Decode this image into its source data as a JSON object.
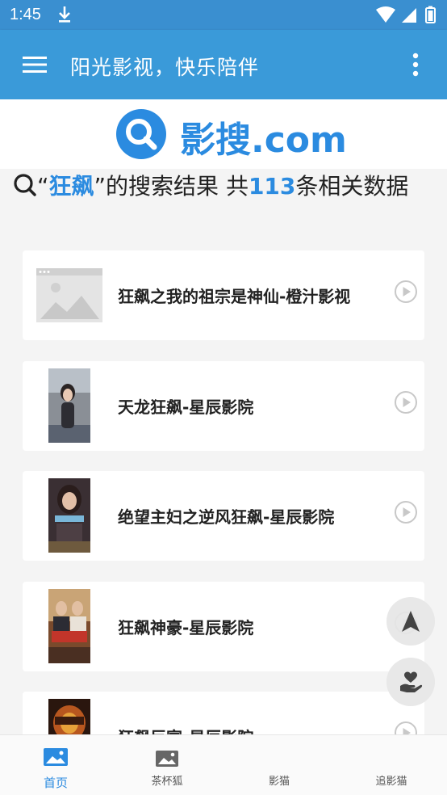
{
  "status_bar": {
    "time": "1:45"
  },
  "app_bar": {
    "title": "阳光影视，快乐陪伴"
  },
  "logo": {
    "text": "影搜.com"
  },
  "search_result": {
    "prefix": "“",
    "keyword": "狂飙",
    "middle": "”的搜索结果 共",
    "count": "113",
    "suffix": "条相关数据"
  },
  "results": [
    {
      "title": "狂飙之我的祖宗是神仙-橙汁影视"
    },
    {
      "title": "天龙狂飙-星辰影院"
    },
    {
      "title": "绝望主妇之逆风狂飙-星辰影院"
    },
    {
      "title": "狂飙神豪-星辰影院"
    },
    {
      "title": "狂飙巨富-星辰影院"
    }
  ],
  "bottom_nav": [
    {
      "label": "首页"
    },
    {
      "label": "茶杯狐"
    },
    {
      "label": "影猫"
    },
    {
      "label": "追影猫"
    }
  ],
  "colors": {
    "accent": "#2b8be0",
    "app_bar": "#3a9ad9"
  }
}
